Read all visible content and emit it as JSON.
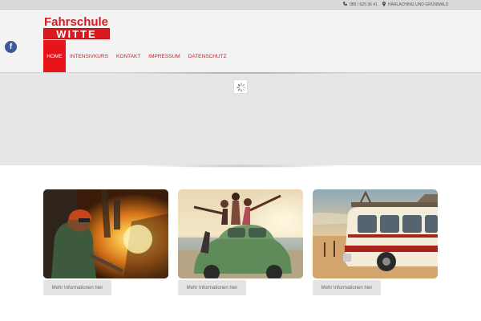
{
  "topbar": {
    "phone": "089 / 625 36 41",
    "location": "HARLACHING UND GRÜNWALD",
    "phone_icon": "phone-icon",
    "location_icon": "map-pin-icon"
  },
  "logo": {
    "line1": "Fahrschule",
    "line2": "WITTE",
    "color": "#d9191e"
  },
  "social": {
    "facebook_icon": "facebook-icon",
    "facebook_glyph": "f",
    "color": "#3b5998"
  },
  "nav": {
    "items": [
      {
        "label": "HOME",
        "active": true
      },
      {
        "label": "INTENSIVKURS",
        "active": false
      },
      {
        "label": "KONTAKT",
        "active": false
      },
      {
        "label": "IMPRESSUM",
        "active": false
      },
      {
        "label": "DATENSCHUTZ",
        "active": false
      }
    ],
    "active_color": "#e8141b"
  },
  "slider": {
    "loading_icon": "spinner-icon"
  },
  "cards": [
    {
      "image": "welding-worker-photo",
      "button_label": "Mehr Informationen hier"
    },
    {
      "image": "friends-on-car-beach-photo",
      "button_label": "Mehr Informationen hier"
    },
    {
      "image": "vintage-bus-beach-photo",
      "button_label": "Mehr Informationen hier"
    }
  ]
}
